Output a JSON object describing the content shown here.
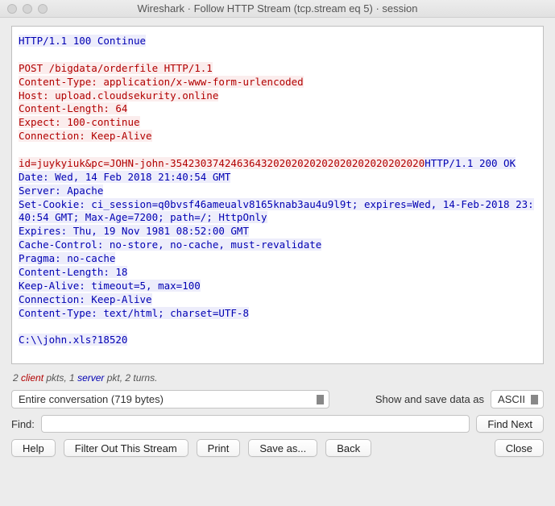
{
  "titlebar": {
    "title": "Wireshark · Follow HTTP Stream (tcp.stream eq 5) · session"
  },
  "stream": {
    "segments": [
      {
        "dir": "server",
        "text": "HTTP/1.1 100 Continue\n\n"
      },
      {
        "dir": "client",
        "text": "POST /bigdata/orderfile HTTP/1.1\nContent-Type: application/x-www-form-urlencoded\nHost: upload.cloudsekurity.online\nContent-Length: 64\nExpect: 100-continue\nConnection: Keep-Alive\n\nid=juykyiuk&pc=JOHN-john-354230374246364320202020202020202020202020"
      },
      {
        "dir": "server",
        "text": "HTTP/1.1 200 OK\nDate: Wed, 14 Feb 2018 21:40:54 GMT\nServer: Apache\nSet-Cookie: ci_session=q0bvsf46ameualv8165knab3au4u9l9t; expires=Wed, 14-Feb-2018 23:40:54 GMT; Max-Age=7200; path=/; HttpOnly\nExpires: Thu, 19 Nov 1981 08:52:00 GMT\nCache-Control: no-store, no-cache, must-revalidate\nPragma: no-cache\nContent-Length: 18\nKeep-Alive: timeout=5, max=100\nConnection: Keep-Alive\nContent-Type: text/html; charset=UTF-8\n\nC:\\\\john.xls?18520"
      }
    ]
  },
  "stats": {
    "prefix": "2 ",
    "client_word": "client",
    "mid1": " pkts, 1 ",
    "server_word": "server",
    "suffix": " pkt, 2 turns."
  },
  "conversation_select": {
    "selected": "Entire conversation (719 bytes)"
  },
  "showsave_label": "Show and save data as",
  "encoding_select": {
    "selected": "ASCII"
  },
  "find": {
    "label": "Find:",
    "value": "",
    "button": "Find Next"
  },
  "buttons": {
    "help": "Help",
    "filter_out": "Filter Out This Stream",
    "print": "Print",
    "save_as": "Save as...",
    "back": "Back",
    "close": "Close"
  }
}
